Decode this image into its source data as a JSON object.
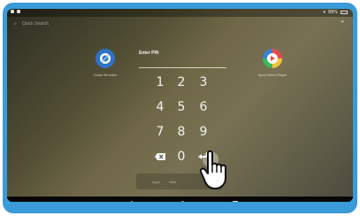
{
  "status_bar": {
    "left_icons": [
      "signal-icon",
      "notification-icon"
    ],
    "right_text": "99%"
  },
  "search": {
    "label": "Quick Search",
    "icon": "search-icon"
  },
  "apps": [
    {
      "label": "Guide Browser",
      "icon": "browser-icon",
      "color": "#2e73c8"
    },
    {
      "label": "Spoil Video Player",
      "icon": "video-player-icon",
      "color": "#3bb85a"
    }
  ],
  "pin": {
    "title": "Enter PIN",
    "keys": [
      "1",
      "2",
      "3",
      "4",
      "5",
      "6",
      "7",
      "8",
      "9",
      "0"
    ]
  },
  "dock": {
    "items": [
      "Apps",
      "Web"
    ]
  },
  "nav": {
    "buttons": [
      "back",
      "home",
      "recents"
    ]
  },
  "colors": {
    "frame": "#3a9bd8",
    "navbar": "#080808"
  }
}
